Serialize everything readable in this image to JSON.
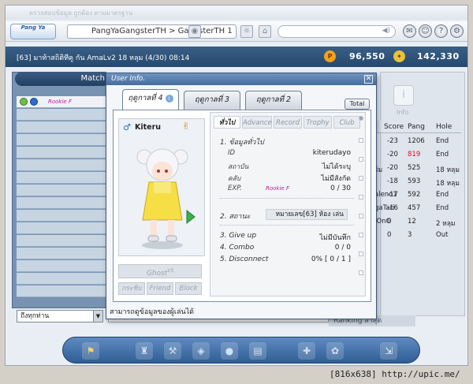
{
  "top": {
    "dim_text": "ตรวจสอบข้อมูล ถูกต้อง ตามมาตรฐาน",
    "logo_text": "Pang Ya",
    "breadcrumb": "PangYaGangsterTH > GangsterTH 1"
  },
  "status": {
    "line": "[63] มาท้าสถิติทีคู กัน    AmaLv2    18 หลุม (4/30)   08:14",
    "pang_icon": "P",
    "pang_amount": "96,550",
    "cookie_amount": "142,330"
  },
  "left": {
    "match_label": "Match",
    "first_user_rank": "Rookie F"
  },
  "right": {
    "info_label": "Info",
    "rank_headers": [
      "Score",
      "Pang",
      "Hole"
    ],
    "rank_rows": [
      {
        "name": "",
        "score": "-23",
        "pang": "1206",
        "hole": "End",
        "pang_color": "#222"
      },
      {
        "name": "",
        "score": "-20",
        "pang": "819",
        "hole": "End",
        "pang_color": "#d0102a"
      },
      {
        "name": "ร์ม",
        "score": "-20",
        "pang": "525",
        "hole": "18 หลุม",
        "pang_color": "#222"
      },
      {
        "name": "",
        "score": "-18",
        "pang": "593",
        "hole": "18 หลุม",
        "pang_color": "#222"
      },
      {
        "name": "aleno1",
        "score": "-17",
        "pang": "592",
        "hole": "End",
        "pang_color": "#222"
      },
      {
        "name": "gaTari",
        "score": "-16",
        "pang": "457",
        "hole": "End",
        "pang_color": "#222"
      },
      {
        "name": "IOnG",
        "score": "0",
        "pang": "12",
        "hole": "2 หลุม",
        "pang_color": "#222"
      },
      {
        "name": "",
        "score": "0",
        "pang": "3",
        "hole": "Out",
        "pang_color": "#222"
      }
    ],
    "ranking_label": "Ranking ล่าสุด"
  },
  "bottom": {
    "whisper_target": "ถึงทุกท่าน"
  },
  "dialog": {
    "title": "User Info.",
    "tabs": [
      "ฤดูกาลที่ 4",
      "ฤดูกาลที่ 3",
      "ฤดูกาลที่ 2"
    ],
    "total_label": "Total",
    "character_name": "Kiteru",
    "ghost_label": "Ghost",
    "ghost_suffix": "VS",
    "action_buttons": [
      "กระซิบ",
      "Friend",
      "Block"
    ],
    "info_tabs": [
      "ทั่วไป",
      "Advance",
      "Record",
      "Trophy",
      "Club"
    ],
    "section1": "1. ข้อมูลทั่วไป",
    "fields": [
      {
        "label": "ID",
        "value": "kiterudayo"
      },
      {
        "label": "สถาบัน",
        "value": "ไม่ได้ระบุ"
      },
      {
        "label": "คลับ",
        "value": "ไม่มีสังกัด"
      },
      {
        "label": "EXP.",
        "value": "0 / 30"
      }
    ],
    "rank": "Rookie F",
    "section2_label": "2. สถานะ",
    "section2_value": "หมายเลข[63] ห้อง เล่น",
    "stats": [
      {
        "label": "3. Give up",
        "value": "ไม่มีบันทึก"
      },
      {
        "label": "4. Combo",
        "value": "0 / 0"
      },
      {
        "label": "5. Disconnect",
        "value": "0% [ 0 / 1 ]"
      }
    ],
    "footer": "สามารถดูข้อมูลของผู้เล่นได้"
  },
  "watermark": "[816x638] http://upic.me/",
  "colors": {
    "accent": "#3a5f86",
    "rookie": "#c4189c",
    "loss_red": "#d0102a"
  }
}
